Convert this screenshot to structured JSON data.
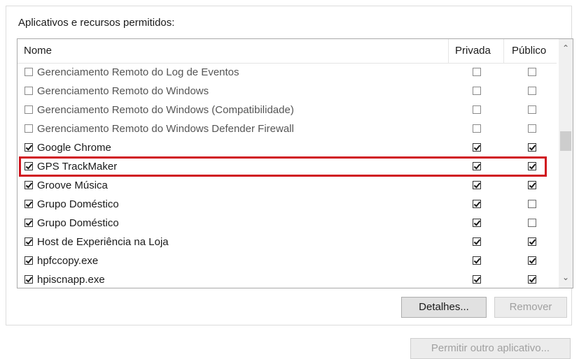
{
  "group_title": "Aplicativos e recursos permitidos:",
  "columns": {
    "name": "Nome",
    "private": "Privada",
    "public": "Público"
  },
  "rows": [
    {
      "name": "Gerenciamento Remoto do Log de Eventos",
      "enabled": false,
      "private": false,
      "public": false
    },
    {
      "name": "Gerenciamento Remoto do Windows",
      "enabled": false,
      "private": false,
      "public": false
    },
    {
      "name": "Gerenciamento Remoto do Windows (Compatibilidade)",
      "enabled": false,
      "private": false,
      "public": false
    },
    {
      "name": "Gerenciamento Remoto do Windows Defender Firewall",
      "enabled": false,
      "private": false,
      "public": false
    },
    {
      "name": "Google Chrome",
      "enabled": true,
      "private": true,
      "public": true
    },
    {
      "name": "GPS TrackMaker",
      "enabled": true,
      "private": true,
      "public": true,
      "highlighted": true
    },
    {
      "name": "Groove Música",
      "enabled": true,
      "private": true,
      "public": true
    },
    {
      "name": "Grupo Doméstico",
      "enabled": true,
      "private": true,
      "public": false
    },
    {
      "name": "Grupo Doméstico",
      "enabled": true,
      "private": true,
      "public": false
    },
    {
      "name": "Host de Experiência na Loja",
      "enabled": true,
      "private": true,
      "public": true
    },
    {
      "name": "hpfccopy.exe",
      "enabled": true,
      "private": true,
      "public": true
    },
    {
      "name": "hpiscnapp.exe",
      "enabled": true,
      "private": true,
      "public": true
    }
  ],
  "buttons": {
    "details": "Detalhes...",
    "remove": "Remover",
    "allow_other": "Permitir outro aplicativo..."
  },
  "colors": {
    "highlight": "#d0141e"
  }
}
